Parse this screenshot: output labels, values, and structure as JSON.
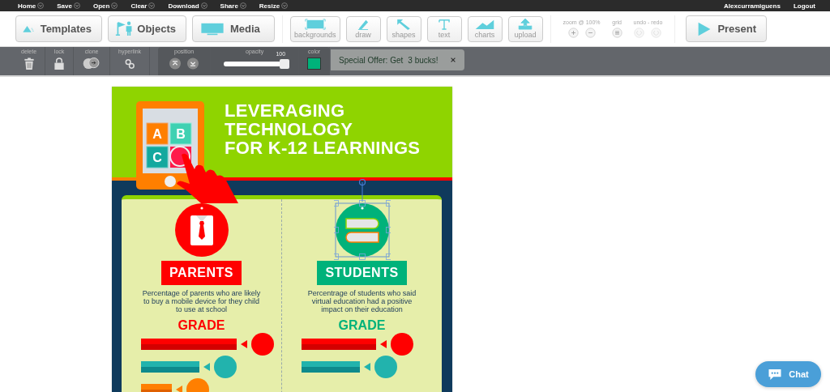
{
  "menu": {
    "items": [
      "Home",
      "Save",
      "Open",
      "Clear",
      "Download",
      "Share",
      "Resize"
    ],
    "user": "Alexcurramiguens",
    "logout": "Logout"
  },
  "toolbar": {
    "main": [
      {
        "label": "Templates",
        "kind": "templates"
      },
      {
        "label": "Objects",
        "kind": "objects"
      },
      {
        "label": "Media",
        "kind": "media"
      }
    ],
    "tools": [
      {
        "label": "backgrounds",
        "kind": "backgrounds"
      },
      {
        "label": "draw",
        "kind": "draw"
      },
      {
        "label": "shapes",
        "kind": "shapes"
      },
      {
        "label": "text",
        "kind": "text"
      },
      {
        "label": "charts",
        "kind": "charts"
      },
      {
        "label": "upload",
        "kind": "upload"
      }
    ],
    "zoom_label": "zoom @ 100%",
    "grid_label": "grid",
    "undo_label": "undo - redo",
    "present": "Present"
  },
  "object_bar": {
    "delete": "delete",
    "lock": "lock",
    "clone": "clone",
    "hyperlink": "hyperlink",
    "position": "position",
    "opacity": {
      "label": "opacity",
      "reading": "100",
      "level": 1.0
    },
    "color": {
      "label": "color",
      "color": "#00b27a"
    }
  },
  "offer": {
    "start": "Special Offer: Get",
    "end": "3 bucks!"
  },
  "infographic": {
    "title": [
      "LEVERAGING",
      "TECHNOLOGY",
      "FOR K-12 LEARNINGS"
    ],
    "tiles": [
      "A",
      "B",
      "C"
    ],
    "columns": [
      {
        "kind": "shirt",
        "heading": "PARENTS",
        "text": "Percentage of parents who are likely to buy a mobile device for they child to use at school",
        "grade": "GRADE",
        "color": "#ff0000"
      },
      {
        "kind": "books",
        "heading": "STUDENTS",
        "text": "Percentrage of students who said virtual education had a positive impact on their education",
        "grade": "GRADE",
        "color": "#00b27a"
      }
    ]
  },
  "chat": "Chat"
}
